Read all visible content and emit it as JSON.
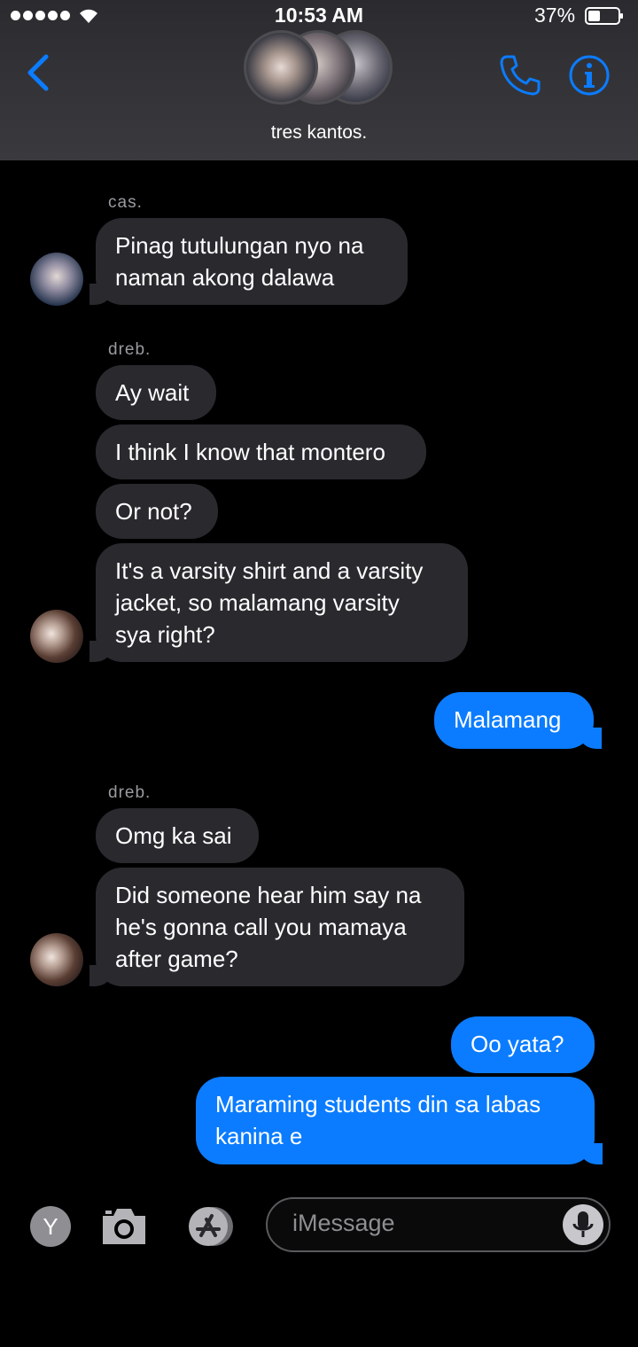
{
  "status_bar": {
    "time": "10:53 AM",
    "battery": "37%"
  },
  "header": {
    "title": "tres kantos."
  },
  "messages": {
    "sender_1": "cas.",
    "m1_line1": "Pinag tutulungan nyo na",
    "m1_line2": "naman akong dalawa",
    "sender_2": "dreb.",
    "m2": "Ay wait",
    "m3": "I think I know that montero",
    "m4": "Or not?",
    "m5_line1": "It's a varsity shirt and a varsity",
    "m5_line2": "jacket, so malamang varsity",
    "m5_line3": "sya right?",
    "m6": "Malamang",
    "sender_3": "dreb.",
    "m7": "Omg ka sai",
    "m8_line1": "Did someone hear him say na",
    "m8_line2": "he's gonna call you mamaya",
    "m8_line3": "after game?",
    "m9": "Oo yata?",
    "m10_line1": "Maraming students din sa labas",
    "m10_line2": "kanina e"
  },
  "composer": {
    "avatar_letter": "Y",
    "placeholder": "iMessage"
  },
  "colors": {
    "accent": "#0b7cff",
    "incoming": "#2a292e",
    "background": "#000000"
  }
}
